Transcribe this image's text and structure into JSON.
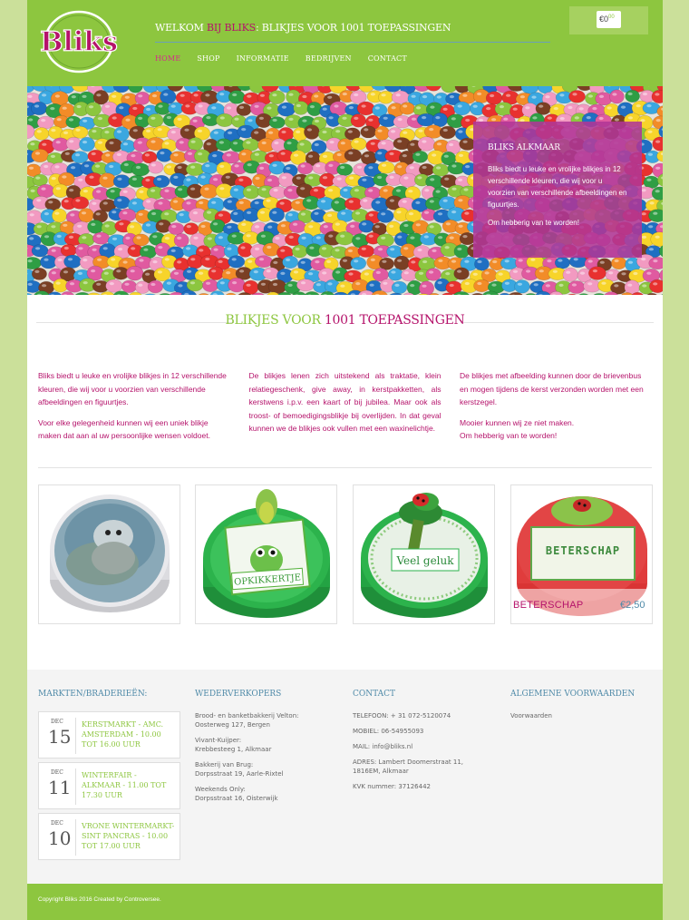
{
  "brand": {
    "logo_text": "Bliks",
    "colors": {
      "green": "#8dc63f",
      "magenta": "#b5136b",
      "blue": "#4f8aa8"
    }
  },
  "header": {
    "tagline_pre": "WELKOM ",
    "tagline_accent": "BIJ BLIKS",
    "tagline_post": ": BLIKJES VOOR 1001 TOEPASSINGEN",
    "nav": [
      {
        "label": "HOME",
        "active": true
      },
      {
        "label": "SHOP"
      },
      {
        "label": "INFORMATIE"
      },
      {
        "label": "BEDRIJVEN"
      },
      {
        "label": "CONTACT"
      }
    ],
    "cart": {
      "currency": "€",
      "amount": "0",
      "cents": "00"
    }
  },
  "hero": {
    "promo_title": "BLIKS ALKMAAR",
    "promo_text": "Bliks biedt u leuke en vrolijke blikjes in 12 verschillende kleuren, die wij voor u voorzien van verschillende afbeeldingen en figuurtjes.",
    "promo_cta": "Om hebberig van te worden!"
  },
  "intro": {
    "title_pre": "BLIKJES VOOR ",
    "title_accent": "1001 TOEPASSINGEN",
    "col1_p1": "Bliks biedt u leuke en vrolijke blikjes in 12 verschillende kleuren, die wij voor u voorzien van verschillende afbeeldingen en figuurtjes.",
    "col1_p2": "Voor elke gelegenheid kunnen wij een uniek blikje maken dat aan al uw persoonlijke wensen voldoet.",
    "col2_p1": "De blikjes lenen zich uitstekend als traktatie, klein relatiegeschenk, give away, in kerstpakketten, als kerstwens i.p.v. een kaart of bij jubilea. Maar ook als troost- of bemoedigingsblikje bij overlijden. In dat geval kunnen we de blikjes ook vullen met een waxinelichtje.",
    "col3_p1": "De blikjes met afbeelding kunnen door de brievenbus en mogen tijdens de kerst verzonden worden met een kerstzegel.",
    "col3_p2a": "Mooier kunnen wij ze niet maken.",
    "col3_p2b": "Om hebberig van te worden!"
  },
  "products": [
    {
      "label": "",
      "price": ""
    },
    {
      "label": "OPKIKKERTJE",
      "price": ""
    },
    {
      "label": "Veel geluk",
      "price": ""
    },
    {
      "label": "BETERSCHAP",
      "price": "€2,50",
      "caption": "BETERSCHAP"
    }
  ],
  "footer": {
    "markets_title": "MARKTEN/BRADERIEËN:",
    "events": [
      {
        "month": "DEC",
        "day": "15",
        "title": "KERSTMARKT - AMC. AMSTERDAM - 10.00 TOT 16.00 UUR"
      },
      {
        "month": "DEC",
        "day": "11",
        "title": "WINTERFAIR - ALKMAAR - 11.00 TOT 17.30 UUR"
      },
      {
        "month": "DEC",
        "day": "10",
        "title": "VRONE WINTERMARKT- SINT PANCRAS - 10.00 TOT 17.00 UUR"
      }
    ],
    "resellers_title": "WEDERVERKOPERS",
    "resellers": [
      {
        "name": "Brood- en banketbakkerij Velton:",
        "address": "Oosterweg 127, Bergen"
      },
      {
        "name": "Vivant-Kuijper:",
        "address": "Krebbesteeg 1, Alkmaar"
      },
      {
        "name": "Bakkerij van Brug:",
        "address": "Dorpsstraat 19, Aarle-Rixtel"
      },
      {
        "name": "Weekends Only:",
        "address": "Dorpsstraat 16, Oisterwijk"
      }
    ],
    "contact_title": "CONTACT",
    "contact": {
      "phone": "TELEFOON: + 31 072-5120074",
      "mobile": "MOBIEL: 06-54955093",
      "mail": "MAIL: info@bliks.nl",
      "address_l1": "ADRES: Lambert Doomerstraat 11,",
      "address_l2": "1816EM, Alkmaar",
      "kvk": "KVK nummer: 37126442"
    },
    "terms_title": "ALGEMENE VOORWAARDEN",
    "terms_link": "Voorwaarden",
    "copyright": "Copyright Bliks 2016 Created by Controversee."
  }
}
